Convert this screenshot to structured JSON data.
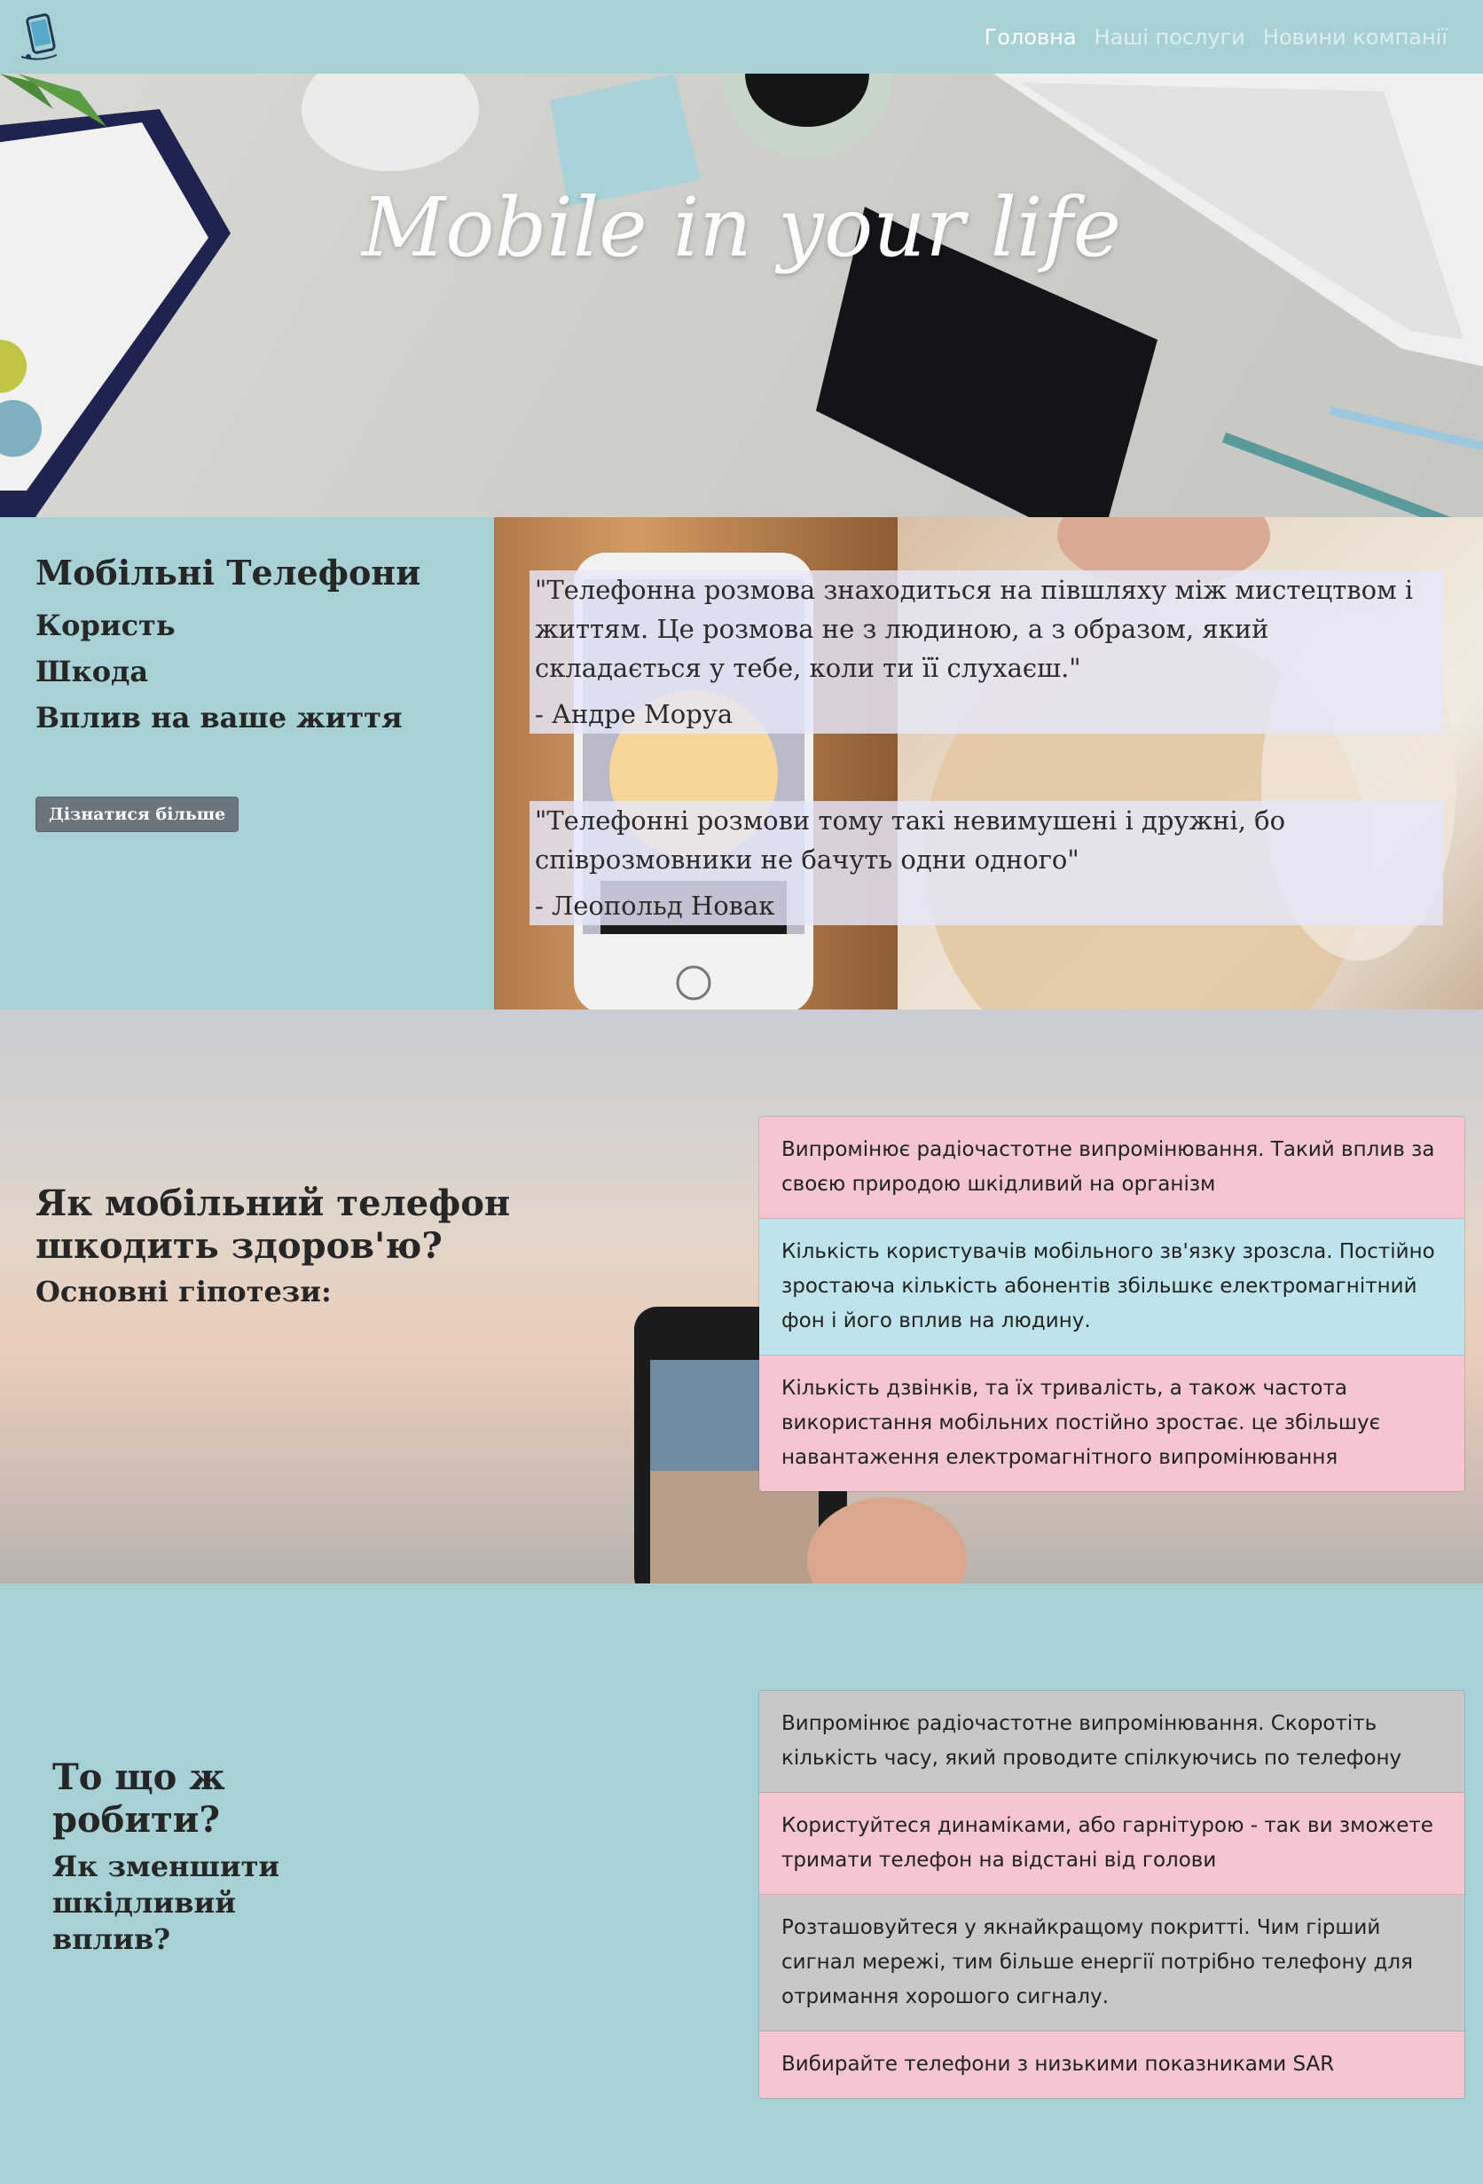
{
  "nav": {
    "links": [
      {
        "label": "Головна"
      },
      {
        "label": "Наші послуги"
      },
      {
        "label": "Новини компанії"
      }
    ]
  },
  "hero": {
    "title": "Mobile in your life"
  },
  "intro": {
    "title": "Мобільні Телефони",
    "items": [
      "Користь",
      "Шкода",
      "Вплив на ваше життя"
    ],
    "button": "Дізнатися більше"
  },
  "quotes": [
    {
      "text": "\"Телефонна розмова знаходиться на півшляху між мистецтвом і життям. Це розмова не з людиною, а з образом, який складається у тебе, коли ти її слухаєш.\"",
      "author": "- Андре Моруа"
    },
    {
      "text": "\"Телефонні розмови тому такі невимушені і дружні, бо співрозмовники не бачуть одни одного\"",
      "author": "- Леопольд Новак"
    }
  ],
  "health": {
    "title": "Як мобільний телефон шкодить здоров'ю?",
    "subtitle": "Основні гіпотези:",
    "items": [
      "Випромінює радіочастотне випромінювання. Такий вплив за своєю природою шкідливий на організм",
      "Кількість користувачів мобільного зв'язку зрозсла. Постійно зростаюча кількість абонентів збільшкє електромагнітний фон і його вплив на людину.",
      "Кількість дзвінків, та їх тривалість, а також частота використання мобільних постійно зростає. це збільшує навантаження електромагнітного випромінювання"
    ]
  },
  "todo": {
    "title": "То що ж робити?",
    "subtitle": "Як зменшити шкідливий вплив?",
    "items": [
      "Випромінює радіочастотне випромінювання. Скоротіть кількість часу, який проводите спілкуючись по телефону",
      "Користуйтеся динаміками, або гарнітурою - так ви зможете тримати телефон на відстані від голови",
      "Розташовуйтеся у якнайкращому покритті. Чим гірший сигнал мережі, тим більше енергії потрібно телефону для отримання хорошого сигналу.",
      "Вибирайте телефони з низькими показниками SAR"
    ]
  }
}
